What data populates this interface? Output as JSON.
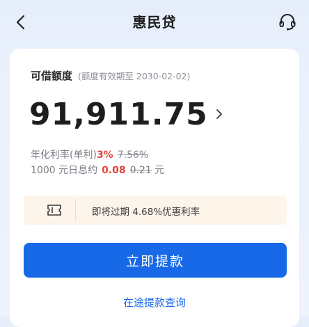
{
  "header": {
    "title": "惠民贷",
    "back_icon": "chevron-left-icon",
    "support_icon": "headset-icon"
  },
  "quota": {
    "title": "可借额度",
    "validity": "(额度有效期至 2030-02-02)",
    "amount": "91,911.75"
  },
  "rate": {
    "label": "年化利率(单利)",
    "current": "3%",
    "original": "7.56%"
  },
  "interest": {
    "prefix": "1000 元日息约",
    "current": "0.08",
    "original": "0.21",
    "unit": "元"
  },
  "promo": {
    "icon": "coupon-icon",
    "text": "即将过期 4.68%优惠利率"
  },
  "actions": {
    "withdraw_label": "立即提款",
    "query_label": "在途提款查询"
  },
  "colors": {
    "primary": "#1769e8",
    "accent_red": "#e0453a",
    "promo_bg": "#fdf4ea"
  }
}
